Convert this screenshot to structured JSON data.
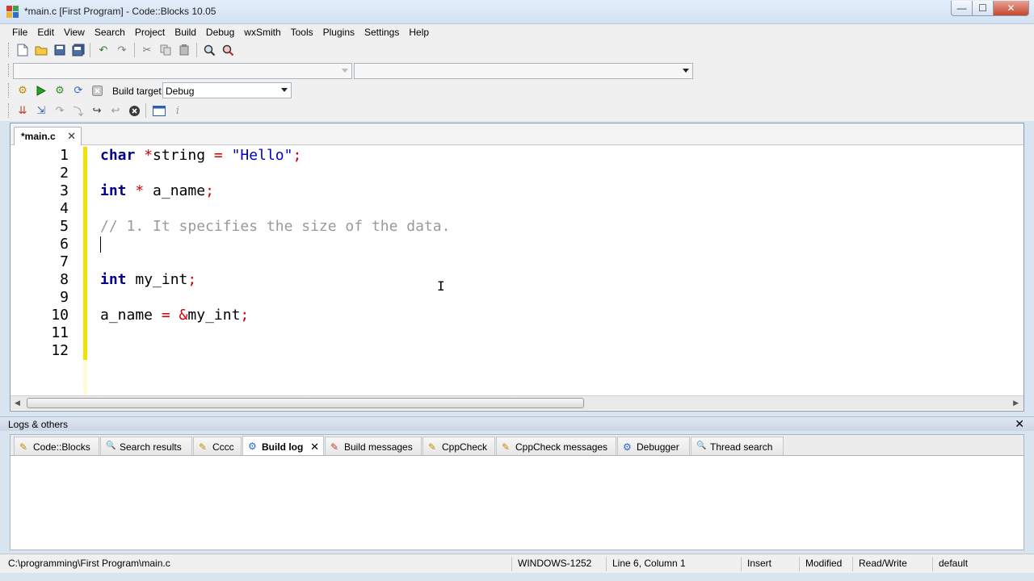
{
  "window": {
    "title": "*main.c [First Program] - Code::Blocks 10.05",
    "min": "—",
    "max": "☐",
    "close": "✕"
  },
  "menu": [
    "File",
    "Edit",
    "View",
    "Search",
    "Project",
    "Build",
    "Debug",
    "wxSmith",
    "Tools",
    "Plugins",
    "Settings",
    "Help"
  ],
  "toolbar": {
    "build_target_label": "Build target:",
    "build_target_value": "Debug"
  },
  "editor": {
    "tab_label": "*main.c",
    "tab_close": "✕",
    "lines": [
      {
        "n": "1"
      },
      {
        "n": "2"
      },
      {
        "n": "3"
      },
      {
        "n": "4"
      },
      {
        "n": "5"
      },
      {
        "n": "6"
      },
      {
        "n": "7"
      },
      {
        "n": "8"
      },
      {
        "n": "9"
      },
      {
        "n": "10"
      },
      {
        "n": "11"
      },
      {
        "n": "12"
      }
    ],
    "tokens": {
      "l1": [
        "char",
        " *",
        "string ",
        "=",
        " ",
        "\"Hello\"",
        ";"
      ],
      "l3": [
        "int",
        " *",
        " a_name",
        ";"
      ],
      "l5": "// 1. It specifies the size of the data.",
      "l8": [
        "int",
        " my_int",
        ";"
      ],
      "l10": [
        "a_name ",
        "=",
        " ",
        "&",
        "my_int",
        ";"
      ]
    },
    "ibeam": "I"
  },
  "logs": {
    "title": "Logs & others",
    "close": "✕",
    "tabs": [
      {
        "label": "Code::Blocks",
        "icon": "✎"
      },
      {
        "label": "Search results",
        "icon": "🔍"
      },
      {
        "label": "Cccc",
        "icon": "✎"
      },
      {
        "label": "Build log",
        "icon": "⚙",
        "active": true
      },
      {
        "label": "Build messages",
        "icon": "✎"
      },
      {
        "label": "CppCheck",
        "icon": "✎"
      },
      {
        "label": "CppCheck messages",
        "icon": "✎"
      },
      {
        "label": "Debugger",
        "icon": "⚙"
      },
      {
        "label": "Thread search",
        "icon": "🔍"
      }
    ]
  },
  "status": {
    "path": "C:\\programming\\First Program\\main.c",
    "encoding": "WINDOWS-1252",
    "position": "Line 6, Column 1",
    "mode": "Insert",
    "modified": "Modified",
    "access": "Read/Write",
    "lexer": "default"
  },
  "colors": {
    "keyword": "#00008b",
    "operator": "#d10000",
    "string": "#0000c0",
    "comment": "#9a9a9a",
    "change_marker": "#f2e000"
  }
}
